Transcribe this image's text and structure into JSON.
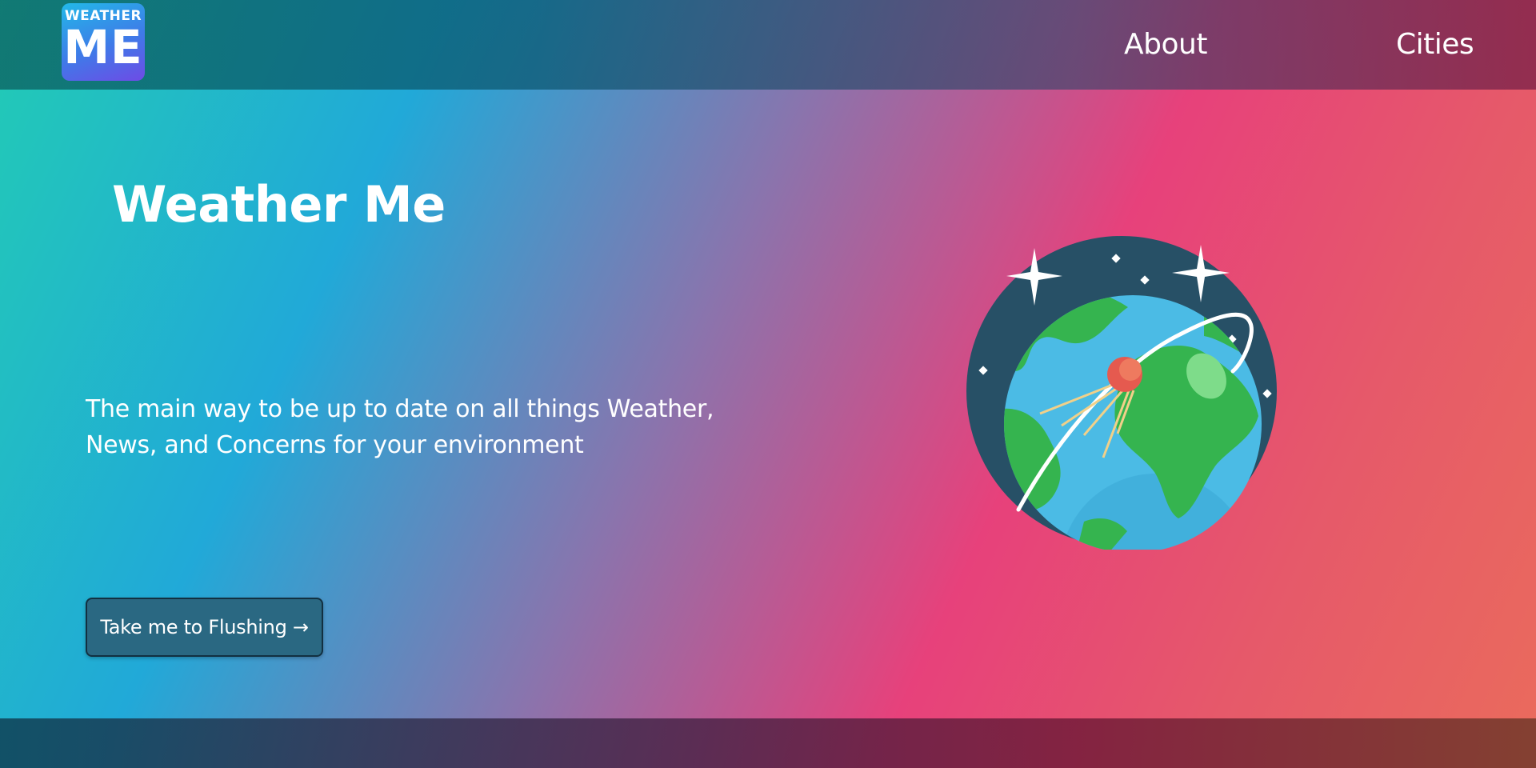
{
  "header": {
    "logo": {
      "line1": "WEATHER",
      "line2": "ME"
    },
    "nav": [
      {
        "label": "About"
      },
      {
        "label": "Cities"
      }
    ]
  },
  "hero": {
    "title": "Weather Me",
    "description": "The main way to be up to date on all things Weather, News, and Concerns for your environment",
    "cta_label": "Take me to Flushing →"
  },
  "illustration": {
    "icon": "globe-satellite-icon"
  },
  "colors": {
    "gradient_start": "#22cbb5",
    "gradient_mid": "#21a9d8",
    "gradient_pink": "#e7417b",
    "gradient_end": "#ea6b5c",
    "button_bg": "#2a6882",
    "globe_space": "#275066",
    "globe_ocean": "#4bbbe5",
    "globe_land": "#35b44f",
    "satellite": "#e55a4f"
  }
}
